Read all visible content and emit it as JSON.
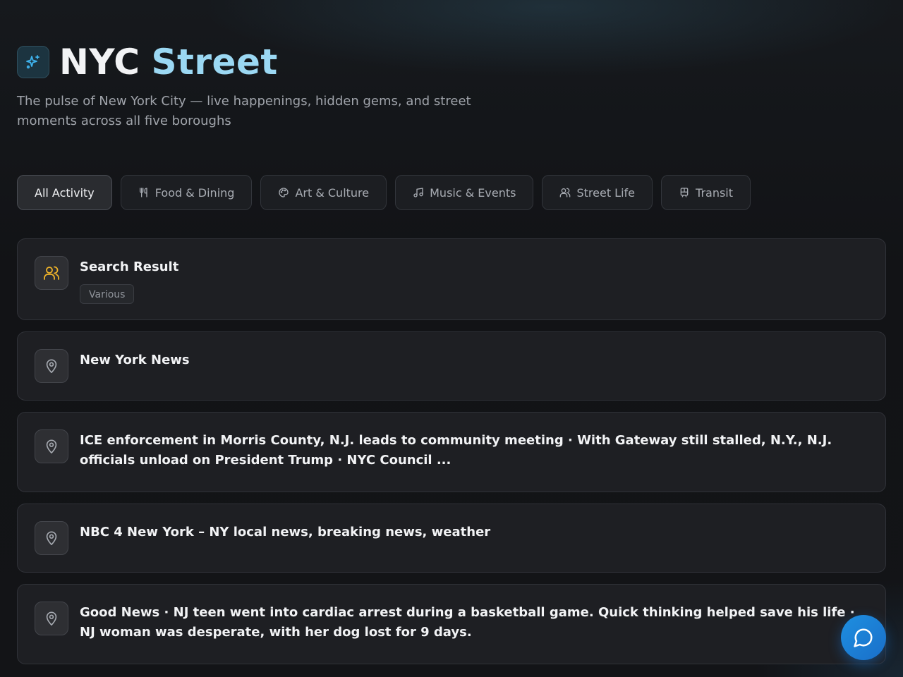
{
  "header": {
    "title_part1": "NYC",
    "title_part2": "Street",
    "subtitle": "The pulse of New York City — live happenings, hidden gems, and street moments across all five boroughs",
    "logo_icon": "sparkles-icon",
    "accent_color": "#9bd8f3"
  },
  "filters": [
    {
      "label": "All Activity",
      "icon": "",
      "active": true
    },
    {
      "label": "Food & Dining",
      "icon": "utensils-icon",
      "active": false
    },
    {
      "label": "Art & Culture",
      "icon": "palette-icon",
      "active": false
    },
    {
      "label": "Music & Events",
      "icon": "music-note-icon",
      "active": false
    },
    {
      "label": "Street Life",
      "icon": "people-icon",
      "active": false
    },
    {
      "label": "Transit",
      "icon": "train-icon",
      "active": false
    }
  ],
  "feed": [
    {
      "title": "Search Result",
      "tag": "Various",
      "icon": "people-icon",
      "icon_color": "#f0b429"
    },
    {
      "title": "New York News",
      "icon": "map-pin-icon",
      "icon_color": "#a8acb3"
    },
    {
      "title": "ICE enforcement in Morris County, N.J. leads to community meeting · With Gateway still stalled, N.Y., N.J. officials unload on President Trump · NYC Council ...",
      "icon": "map-pin-icon",
      "icon_color": "#a8acb3"
    },
    {
      "title": "NBC 4 New York – NY local news, breaking news, weather",
      "icon": "map-pin-icon",
      "icon_color": "#a8acb3"
    },
    {
      "title": "Good News · NJ teen went into cardiac arrest during a basketball game. Quick thinking helped save his life · NJ woman was desperate, with her dog lost for 9 days.",
      "icon": "map-pin-icon",
      "icon_color": "#a8acb3"
    }
  ],
  "chat": {
    "icon": "chat-bubble-icon",
    "color": "#1e8fe0"
  }
}
